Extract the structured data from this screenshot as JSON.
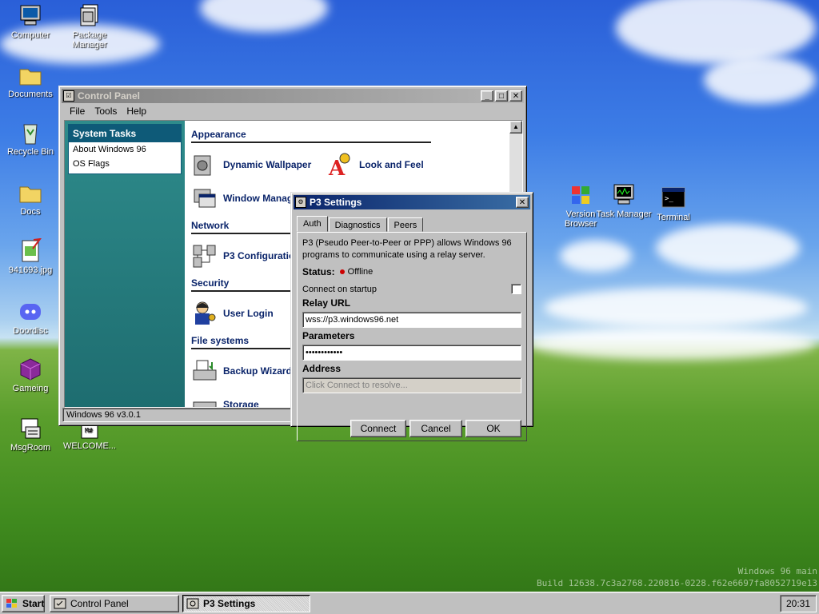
{
  "desktop": {
    "icons_left": [
      {
        "label": "Computer"
      },
      {
        "label": "Documents"
      },
      {
        "label": "Recycle Bin"
      },
      {
        "label": "Docs"
      },
      {
        "label": "941693.jpg"
      },
      {
        "label": "Doordisc"
      },
      {
        "label": "Gameing"
      },
      {
        "label": "MsgRoom"
      }
    ],
    "icons_col2": [
      {
        "label": "Package Manager"
      },
      {
        "label": "WELCOME..."
      }
    ],
    "icons_right": [
      {
        "label": "Version Browser"
      },
      {
        "label": "Task Manager"
      },
      {
        "label": "Terminal"
      }
    ],
    "build_line1": "Windows 96 main",
    "build_line2": "Build 12638.7c3a2768.220816-0228.f62e6697fa8052719e13"
  },
  "control_panel": {
    "title": "Control Panel",
    "menu": [
      "File",
      "Tools",
      "Help"
    ],
    "tasks_header": "System Tasks",
    "tasks": [
      "About Windows 96",
      "OS Flags"
    ],
    "sections": {
      "appearance": "Appearance",
      "network": "Network",
      "security": "Security",
      "filesystems": "File systems"
    },
    "applets": {
      "dynamic_wallpaper": "Dynamic Wallpaper",
      "look_and_feel": "Look and Feel",
      "window_manager": "Window Manag",
      "p3_configuration": "P3 Configuratio",
      "user_login": "User Login",
      "backup_wizard": "Backup Wizard",
      "storage": "Storage"
    },
    "status": "Windows 96 v3.0.1"
  },
  "p3_dialog": {
    "title": "P3 Settings",
    "tabs": [
      "Auth",
      "Diagnostics",
      "Peers"
    ],
    "description": "P3 (Pseudo Peer-to-Peer or PPP) allows Windows 96 programs to communicate using a relay server.",
    "status_label": "Status:",
    "status_value": "Offline",
    "connect_on_startup_label": "Connect on startup",
    "relay_url_label": "Relay URL",
    "relay_url_value": "wss://p3.windows96.net",
    "parameters_label": "Parameters",
    "parameters_value": "••••••••••••",
    "address_label": "Address",
    "address_placeholder": "Click Connect to resolve...",
    "buttons": {
      "connect": "Connect",
      "cancel": "Cancel",
      "ok": "OK"
    },
    "colors": {
      "status_offline": "#cc0000"
    }
  },
  "taskbar": {
    "start_label": "Start",
    "items": [
      {
        "label": "Control Panel"
      },
      {
        "label": "P3 Settings"
      }
    ],
    "clock": "20:31"
  }
}
